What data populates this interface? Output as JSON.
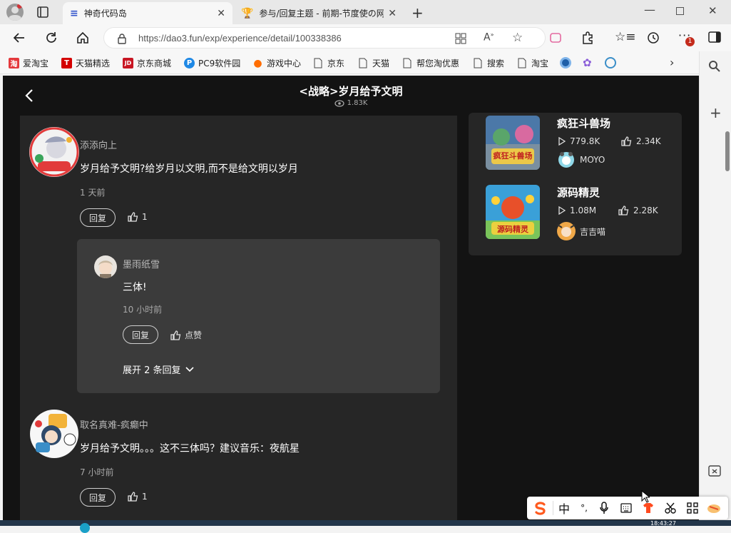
{
  "browser": {
    "tabs": [
      {
        "title": "神奇代码岛",
        "active": true
      },
      {
        "title": "参与/回复主题 - 前期-节度使の网",
        "active": false
      }
    ],
    "url": "https://dao3.fun/exp/experience/detail/100338386",
    "bookmarks": [
      {
        "label": "爱淘宝",
        "color": "#e4393c",
        "glyph": "淘"
      },
      {
        "label": "天猫精选",
        "color": "#d40000",
        "glyph": "T"
      },
      {
        "label": "京东商城",
        "color": "#c81623",
        "glyph": "JD"
      },
      {
        "label": "PC9软件园",
        "color": "#1e88e5",
        "glyph": "P"
      },
      {
        "label": "游戏中心",
        "color": "#ff6d00",
        "glyph": "●"
      },
      {
        "label": "京东",
        "color": "",
        "glyph": ""
      },
      {
        "label": "天猫",
        "color": "",
        "glyph": ""
      },
      {
        "label": "帮您淘优惠",
        "color": "",
        "glyph": ""
      },
      {
        "label": "搜索",
        "color": "",
        "glyph": ""
      },
      {
        "label": "淘宝",
        "color": "",
        "glyph": ""
      }
    ],
    "notification_count": "1"
  },
  "page": {
    "title": "<战略>岁月给予文明",
    "views": "1.83K"
  },
  "comments": [
    {
      "user": "添添向上",
      "text": "岁月给予文明?给岁月以文明,而不是给文明以岁月",
      "time": "1 天前",
      "reply_label": "回复",
      "likes": "1",
      "replies": [
        {
          "user": "墨雨纸雪",
          "text": "三体!",
          "time": "10 小时前",
          "reply_label": "回复",
          "like_label": "点赞"
        }
      ],
      "expand_label": "展开 2 条回复"
    },
    {
      "user": "取名真难-疯癫中",
      "text": "岁月给予文明。。。这不三体吗？建议音乐：夜航星",
      "time": "7 小时前",
      "reply_label": "回复",
      "likes": "1"
    }
  ],
  "recommended": [
    {
      "name": "疯狂斗兽场",
      "thumb_text": "疯狂斗兽场",
      "plays": "779.8K",
      "likes": "2.34K",
      "author": "MOYO"
    },
    {
      "name": "源码精灵",
      "thumb_text": "源码精灵",
      "plays": "1.08M",
      "likes": "2.28K",
      "author": "吉吉喵"
    }
  ],
  "ime": {
    "lang": "中",
    "extra": "°,"
  },
  "taskbar_time": "18:43:27",
  "colors": {
    "page_bg": "#131313",
    "panel_bg": "#262626",
    "sub_bg": "#3b3b3b",
    "text": "#ffffff"
  }
}
